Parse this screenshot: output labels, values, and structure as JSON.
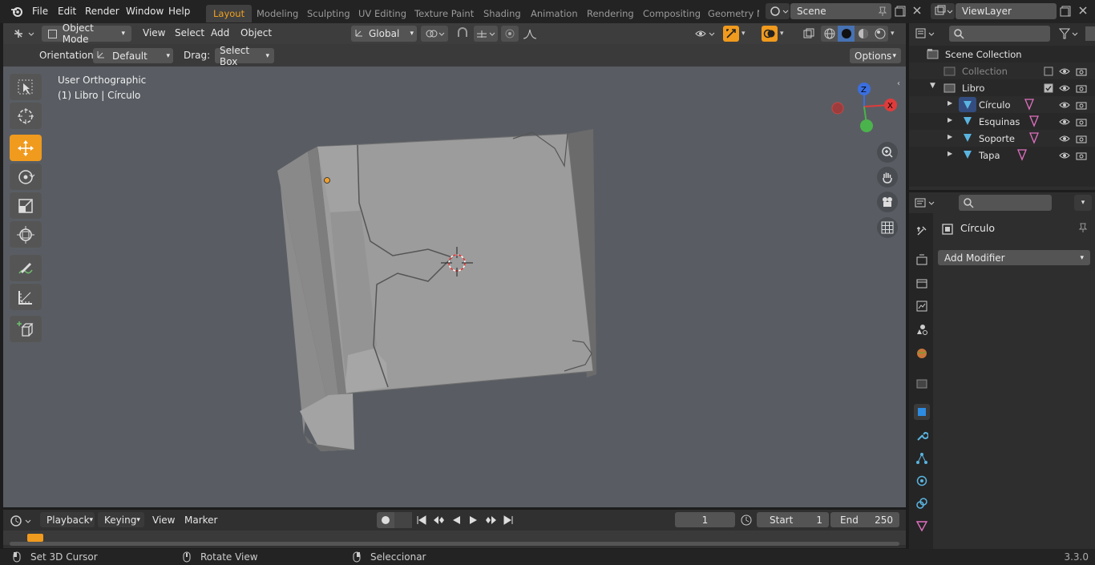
{
  "topbar": {
    "menus": [
      "File",
      "Edit",
      "Render",
      "Window",
      "Help"
    ],
    "workspaces": [
      "Layout",
      "Modeling",
      "Sculpting",
      "UV Editing",
      "Texture Paint",
      "Shading",
      "Animation",
      "Rendering",
      "Compositing",
      "Geometry No"
    ],
    "active_workspace": "Layout",
    "scene": "Scene",
    "view_layer": "ViewLayer"
  },
  "view_header": {
    "mode": "Object Mode",
    "menus": [
      "View",
      "Select",
      "Add",
      "Object"
    ],
    "transform_orientation": "Global"
  },
  "tool_header": {
    "orientation_label": "Orientation",
    "orientation_value": "Default",
    "drag_label": "Drag:",
    "drag_value": "Select Box",
    "options": "Options"
  },
  "viewport": {
    "view_name": "User Orthographic",
    "context": "(1) Libro | Círculo",
    "gizmo": {
      "x": "X",
      "y": "Y",
      "z": "Z"
    }
  },
  "timeline": {
    "menus": [
      "Playback",
      "Keying",
      "View",
      "Marker"
    ],
    "current_frame": "1",
    "start_label": "Start",
    "start_value": "1",
    "end_label": "End",
    "end_value": "250"
  },
  "statusbar": {
    "hint1": "Set 3D Cursor",
    "hint2": "Rotate View",
    "hint3": "Seleccionar",
    "version": "3.3.0"
  },
  "outliner": {
    "items": [
      {
        "label": "Scene Collection",
        "level": 0
      },
      {
        "label": "Collection",
        "level": 1,
        "dim": true
      },
      {
        "label": "Libro",
        "level": 1
      },
      {
        "label": "Círculo",
        "level": 2
      },
      {
        "label": "Esquinas",
        "level": 2
      },
      {
        "label": "Soporte",
        "level": 2
      },
      {
        "label": "Tapa",
        "level": 2
      }
    ]
  },
  "properties": {
    "object_name": "Círculo",
    "add_modifier": "Add Modifier"
  },
  "colors": {
    "accent": "#f09a1e",
    "viewport_bg": "#595d63",
    "panel_bg": "#2e2e2e"
  }
}
